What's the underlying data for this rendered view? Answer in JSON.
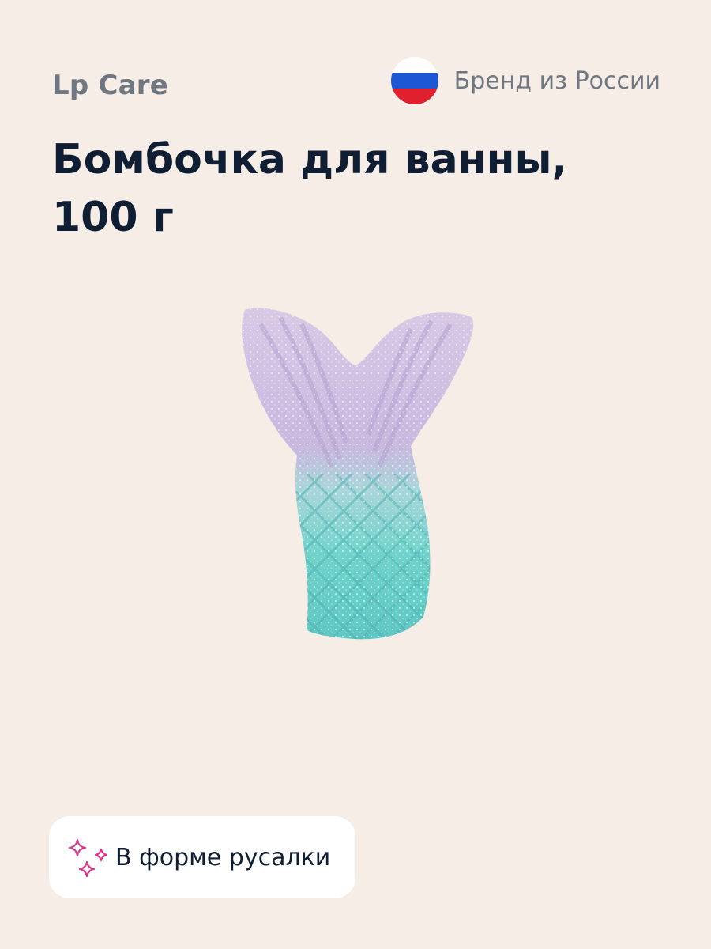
{
  "brand": "Lp Care",
  "origin": {
    "label": "Бренд из России",
    "flag_icon": "russia-flag-icon",
    "flag_colors": [
      "#ffffff",
      "#1c57d4",
      "#e0202c"
    ]
  },
  "product": {
    "title_line1": "Бомбочка для ванны,",
    "title_line2": "100 г",
    "image_icon": "mermaid-tail-bath-bomb-image"
  },
  "feature": {
    "icon": "sparkles-icon",
    "label": "В форме русалки",
    "icon_color": "#d63a86"
  },
  "colors": {
    "background": "#f6ede7",
    "title": "#0f1e33",
    "muted": "#6f7780",
    "badge": "#ffffff"
  }
}
